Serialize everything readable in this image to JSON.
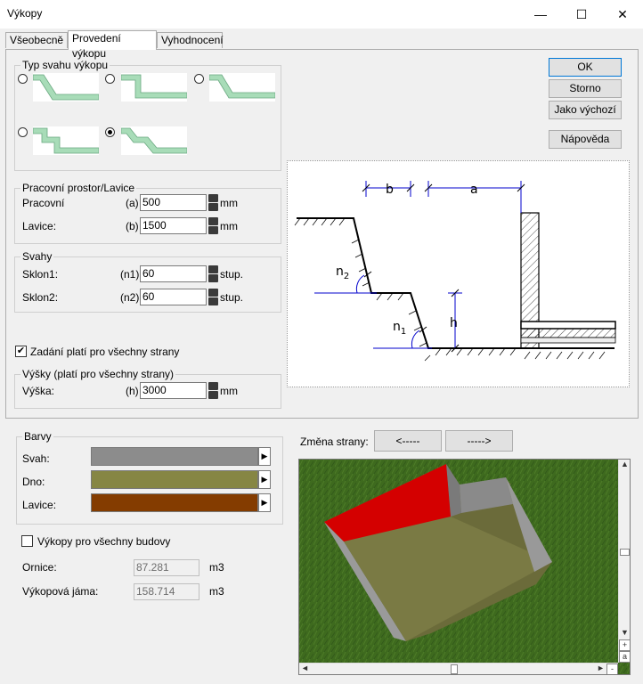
{
  "window": {
    "title": "Výkopy",
    "minimize": "—",
    "maximize": "☐",
    "close": "✕"
  },
  "tabs": [
    "Všeobecně",
    "Provedení výkopu",
    "Vyhodnocení"
  ],
  "slope_type": {
    "legend": "Typ svahu výkopu",
    "selected_index": 4
  },
  "buttons": {
    "ok": "OK",
    "cancel": "Storno",
    "default": "Jako výchozí",
    "help": "Nápověda"
  },
  "workspace": {
    "legend": "Pracovní prostor/Lavice",
    "working": {
      "label": "Pracovní",
      "tag": "(a)",
      "value": "500",
      "unit": "mm"
    },
    "bench": {
      "label": "Lavice:",
      "tag": "(b)",
      "value": "1500",
      "unit": "mm"
    }
  },
  "slopes": {
    "legend": "Svahy",
    "slope1": {
      "label": "Sklon1:",
      "tag": "(n1)",
      "value": "60",
      "unit": "stup."
    },
    "slope2": {
      "label": "Sklon2:",
      "tag": "(n2)",
      "value": "60",
      "unit": "stup."
    }
  },
  "all_sides": {
    "label": "Zadání platí pro všechny strany",
    "checked": true
  },
  "heights": {
    "legend": "Výšky (platí pro všechny strany)",
    "label": "Výška:",
    "tag": "(h)",
    "value": "3000",
    "unit": "mm"
  },
  "diagram": {
    "b": "b",
    "a": "a",
    "n2": "n",
    "n2_sub": "2",
    "n1": "n",
    "n1_sub": "1",
    "h": "h"
  },
  "colors": {
    "legend": "Barvy",
    "slope": {
      "label": "Svah:",
      "color": "#8c8c8c"
    },
    "bottom": {
      "label": "Dno:",
      "color": "#868644"
    },
    "bench": {
      "label": "Lavice:",
      "color": "#843c00"
    }
  },
  "all_buildings": {
    "label": "Výkopy pro všechny budovy",
    "checked": false
  },
  "topsoil": {
    "label": "Ornice:",
    "value": "87.281",
    "unit": "m3"
  },
  "pit": {
    "label": "Výkopová jáma:",
    "value": "158.714",
    "unit": "m3"
  },
  "side_change": {
    "label": "Změna strany:",
    "prev": "<-----",
    "next": "----->"
  },
  "view3d": {
    "grass": "#3e6a1e",
    "red": "#d40000",
    "floor": "#7a7a44",
    "wall": "#8a8a8a"
  },
  "scrollbar": {
    "up": "▲",
    "down": "▼",
    "left": "◄",
    "right": "►",
    "plus": "+",
    "minus": "-",
    "auto": "a"
  }
}
